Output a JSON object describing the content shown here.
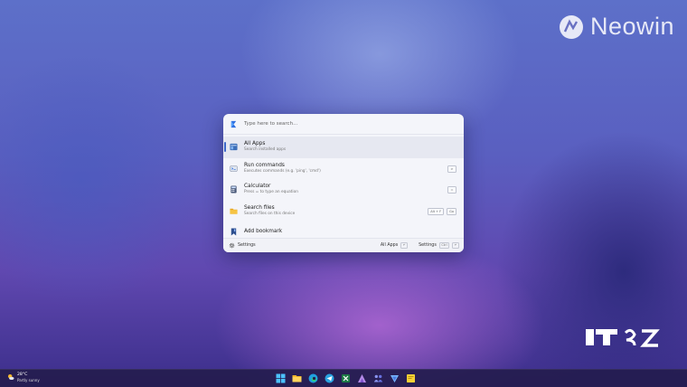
{
  "watermark": {
    "brand": "Neowin",
    "corner_logo_text": "ITSZ"
  },
  "palette": {
    "search": {
      "placeholder": "Type here to search..."
    },
    "results": [
      {
        "title": "All Apps",
        "subtitle": "Search installed apps",
        "icon": "all-apps-icon",
        "selected": true,
        "shortcut": []
      },
      {
        "title": "Run commands",
        "subtitle": "Executes commands (e.g. 'ping', 'cmd')",
        "icon": "terminal-icon",
        "selected": false,
        "shortcut": [
          ">"
        ]
      },
      {
        "title": "Calculator",
        "subtitle": "Press = to type an equation",
        "icon": "calculator-icon",
        "selected": false,
        "shortcut": [
          "="
        ]
      },
      {
        "title": "Search files",
        "subtitle": "Search files on this device",
        "icon": "folder-icon",
        "selected": false,
        "shortcut": [
          "Alt + F",
          "Go"
        ]
      },
      {
        "title": "Add bookmark",
        "subtitle": "",
        "icon": "bookmark-icon",
        "selected": false,
        "shortcut": []
      }
    ],
    "footer": {
      "settings_label": "Settings",
      "all_apps_label": "All Apps",
      "all_apps_key": "↵",
      "settings_action_label": "Settings",
      "settings_key_1": "Ctrl",
      "settings_key_2": "↵"
    }
  },
  "taskbar": {
    "weather": {
      "temp": "28°C",
      "condition": "Partly sunny"
    },
    "apps": [
      "windows-start-icon",
      "file-explorer-icon",
      "edge-icon",
      "telegram-icon",
      "excel-icon",
      "app-icon",
      "teams-icon",
      "vpn-icon",
      "sticky-notes-icon"
    ]
  },
  "colors": {
    "accent": "#3a66c8",
    "palette_bg": "#f4f5fa",
    "taskbar_bg": "#241c4e"
  }
}
